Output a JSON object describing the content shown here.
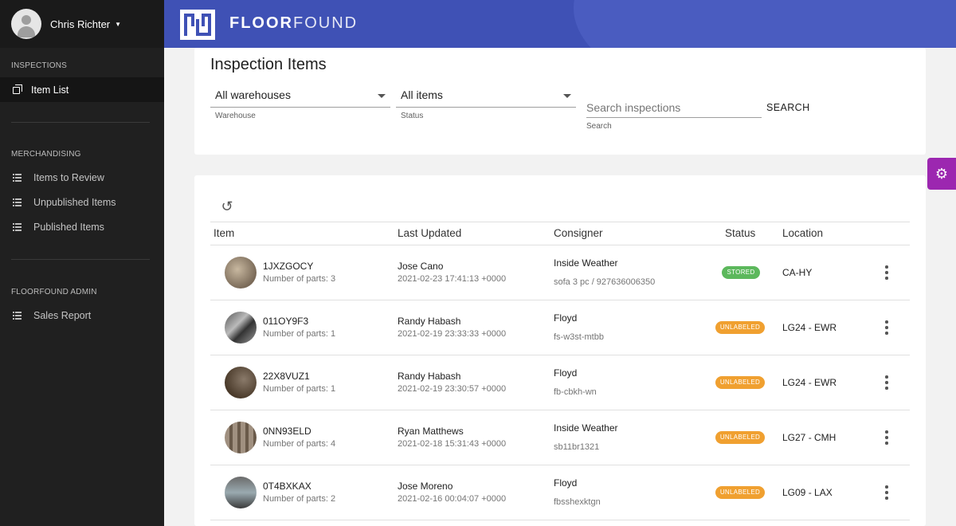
{
  "user": {
    "name": "Chris Richter"
  },
  "brand": {
    "bold": "FLOOR",
    "light": "FOUND"
  },
  "sidebar": {
    "sections": [
      {
        "title": "INSPECTIONS",
        "items": [
          {
            "label": "Item List",
            "icon": "copy-icon",
            "active": true
          }
        ]
      },
      {
        "title": "MERCHANDISING",
        "items": [
          {
            "label": "Items to Review",
            "icon": "list-icon"
          },
          {
            "label": "Unpublished Items",
            "icon": "list-icon"
          },
          {
            "label": "Published Items",
            "icon": "list-icon"
          }
        ]
      },
      {
        "title": "FLOORFOUND ADMIN",
        "items": [
          {
            "label": "Sales Report",
            "icon": "list-icon"
          }
        ]
      }
    ]
  },
  "filters": {
    "title": "Inspection Items",
    "warehouse": {
      "value": "All warehouses",
      "helper": "Warehouse"
    },
    "status": {
      "value": "All items",
      "helper": "Status"
    },
    "search": {
      "placeholder": "Search inspections",
      "helper": "Search",
      "button": "SEARCH"
    }
  },
  "table": {
    "columns": {
      "item": "Item",
      "updated": "Last Updated",
      "consigner": "Consigner",
      "status": "Status",
      "location": "Location"
    },
    "rows": [
      {
        "id": "1JXZGOCY",
        "parts": "Number of parts: 3",
        "updater": "Jose Cano",
        "time": "2021-02-23 17:41:13 +0000",
        "consigner": "Inside Weather",
        "consigner_sub": "sofa 3 pc / 927636006350",
        "status": "STORED",
        "location": "CA-HY"
      },
      {
        "id": "011OY9F3",
        "parts": "Number of parts: 1",
        "updater": "Randy Habash",
        "time": "2021-02-19 23:33:33 +0000",
        "consigner": "Floyd",
        "consigner_sub": "fs-w3st-mtbb",
        "status": "UNLABELED",
        "location": "LG24 - EWR"
      },
      {
        "id": "22X8VUZ1",
        "parts": "Number of parts: 1",
        "updater": "Randy Habash",
        "time": "2021-02-19 23:30:57 +0000",
        "consigner": "Floyd",
        "consigner_sub": "fb-cbkh-wn",
        "status": "UNLABELED",
        "location": "LG24 - EWR"
      },
      {
        "id": "0NN93ELD",
        "parts": "Number of parts: 4",
        "updater": "Ryan Matthews",
        "time": "2021-02-18 15:31:43 +0000",
        "consigner": "Inside Weather",
        "consigner_sub": "sb11br1321",
        "status": "UNLABELED",
        "location": "LG27 - CMH"
      },
      {
        "id": "0T4BXKAX",
        "parts": "Number of parts: 2",
        "updater": "Jose Moreno",
        "time": "2021-02-16 00:04:07 +0000",
        "consigner": "Floyd",
        "consigner_sub": "fbsshexktgn",
        "status": "UNLABELED",
        "location": "LG09 - LAX"
      }
    ]
  },
  "colors": {
    "header": "#3f51b5",
    "sidebar": "#202020",
    "stored": "#5cb85c",
    "unlabeled": "#f0a030",
    "gear": "#9c27b0"
  }
}
